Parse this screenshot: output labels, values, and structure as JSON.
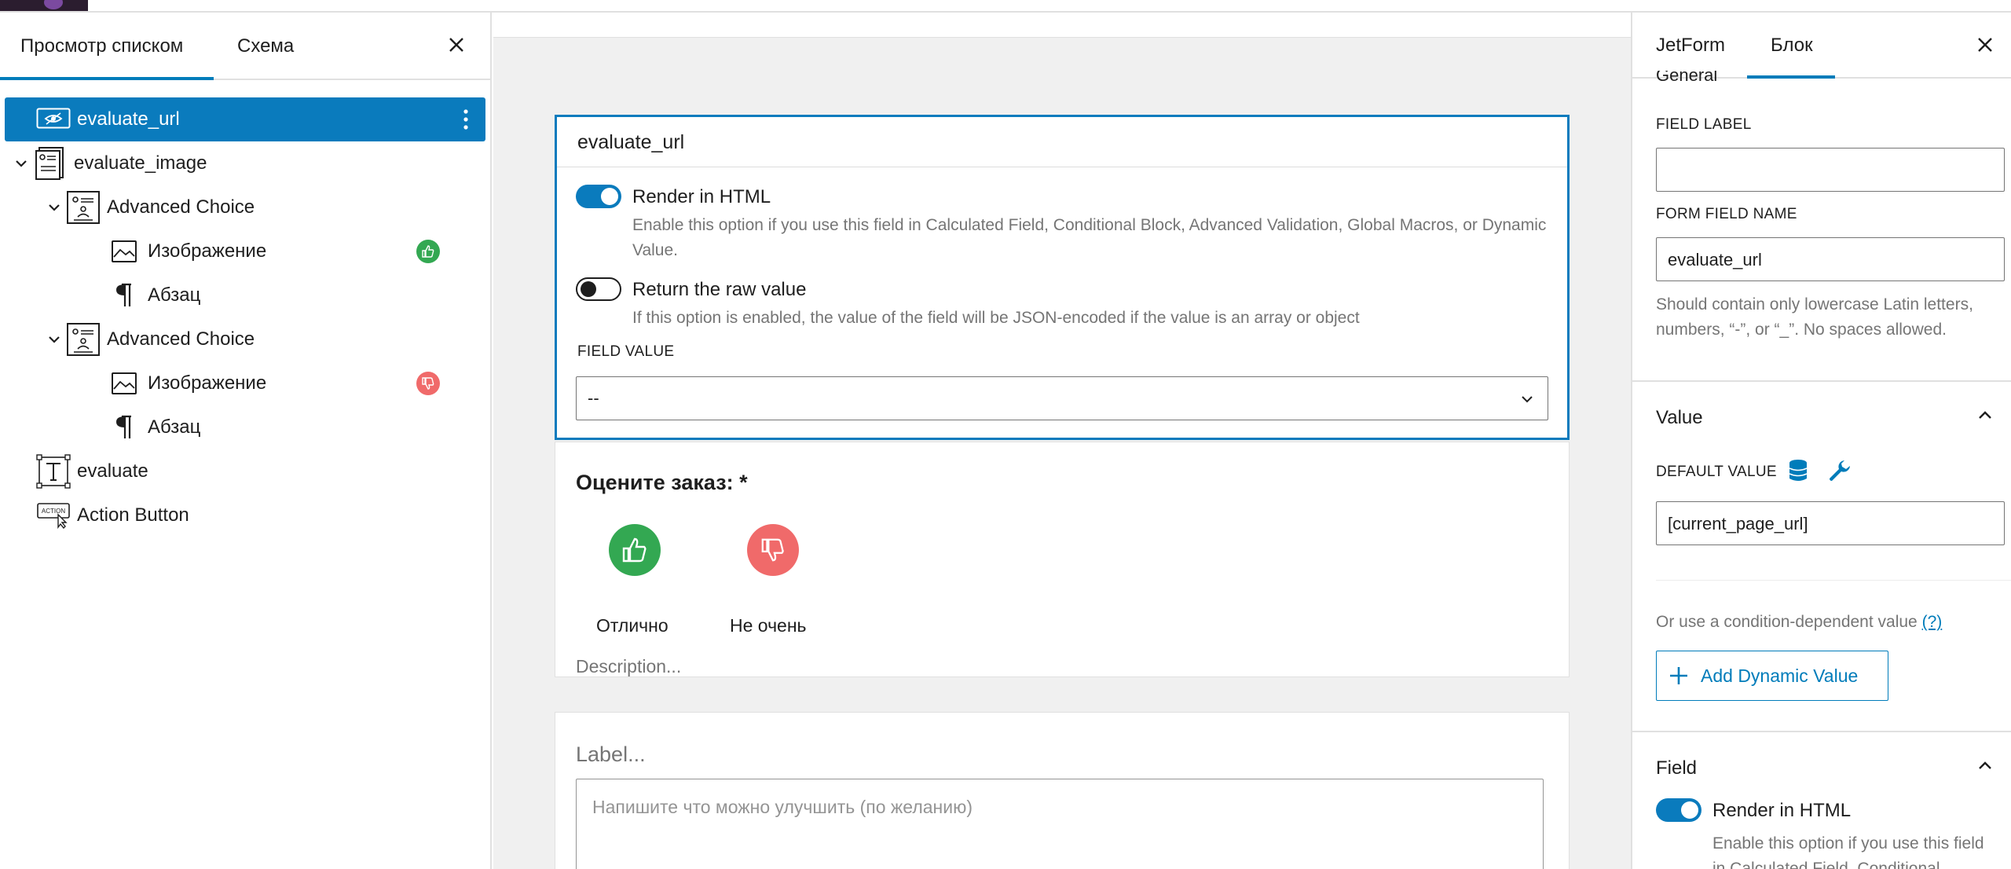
{
  "left_panel": {
    "tabs": [
      "Просмотр списком",
      "Схема"
    ],
    "active_tab": "Просмотр списком",
    "tree": [
      {
        "label": "evaluate_url",
        "icon": "hidden-field-icon",
        "selected": true,
        "depth": 0
      },
      {
        "label": "evaluate_image",
        "icon": "form-block-icon",
        "expanded": true,
        "depth": 0
      },
      {
        "label": "Advanced Choice",
        "icon": "advanced-choice-icon",
        "expanded": true,
        "depth": 1
      },
      {
        "label": "Изображение",
        "icon": "image-icon",
        "badge": "thumbs-up",
        "depth": 2
      },
      {
        "label": "Абзац",
        "icon": "paragraph-icon",
        "depth": 2
      },
      {
        "label": "Advanced Choice",
        "icon": "advanced-choice-icon",
        "expanded": true,
        "depth": 1
      },
      {
        "label": "Изображение",
        "icon": "image-icon",
        "badge": "thumbs-down",
        "depth": 2
      },
      {
        "label": "Абзац",
        "icon": "paragraph-icon",
        "depth": 2
      },
      {
        "label": "evaluate",
        "icon": "text-field-icon",
        "depth": 0
      },
      {
        "label": "Action Button",
        "icon": "action-button-icon",
        "depth": 0
      }
    ]
  },
  "canvas": {
    "hidden_field": {
      "title": "evaluate_url",
      "render_in_html": {
        "label": "Render in HTML",
        "on": true,
        "help": "Enable this option if you use this field in Calculated Field, Conditional Block, Advanced Validation, Global Macros, or Dynamic Value."
      },
      "raw_value": {
        "label": "Return the raw value",
        "on": false,
        "help": "If this option is enabled, the value of the field will be JSON-encoded if the value is an array or object"
      },
      "field_value_label": "FIELD VALUE",
      "field_value": "--"
    },
    "choice_block": {
      "question": "Оцените заказ: *",
      "choices": [
        {
          "label": "Отлично",
          "icon": "thumbs-up-icon",
          "color": "#33a852"
        },
        {
          "label": "Не очень",
          "icon": "thumbs-down-icon",
          "color": "#f06a6a"
        }
      ],
      "description": "Description..."
    },
    "textarea_block": {
      "label": "Label...",
      "placeholder": "Напишите что можно улучшить (по желанию)"
    }
  },
  "right_panel": {
    "tabs": [
      "JetForm",
      "Блок"
    ],
    "active_tab": "Блок",
    "cut_heading": "General",
    "field_label_caption": "FIELD LABEL",
    "field_label_value": "",
    "form_field_name_caption": "FORM FIELD NAME",
    "form_field_name_value": "evaluate_url",
    "name_help": "Should contain only lowercase Latin letters, numbers, “-”, or “_”. No spaces allowed.",
    "value_panel": {
      "title": "Value",
      "default_value_caption": "DEFAULT VALUE",
      "default_value": "[current_page_url]",
      "condition_text": "Or use a condition-dependent value",
      "condition_link": "(?)",
      "add_dynamic_button": "Add Dynamic Value"
    },
    "field_panel": {
      "title": "Field",
      "render_in_html": "Render in HTML",
      "render_on": true,
      "help": "Enable this option if you use this field in Calculated Field, Conditional"
    }
  },
  "colors": {
    "accent": "#007cba",
    "selected_row": "#0a7bbd",
    "good": "#33a852",
    "bad": "#f06a6a"
  }
}
